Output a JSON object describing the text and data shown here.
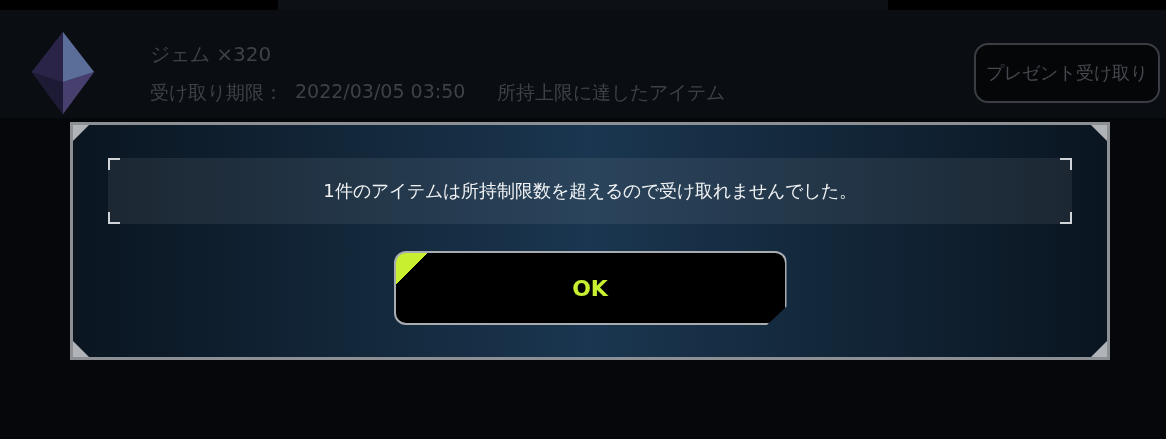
{
  "present_item": {
    "name": "ジェム ×320",
    "deadline_label": "受け取り期限：",
    "deadline": "2022/03/05 03:50",
    "note": "所持上限に達したアイテム",
    "claim_button": "プレゼント受け取り"
  },
  "dialog": {
    "message": "1件のアイテムは所持制限数を超えるので受け取れませんでした。",
    "button": "OK"
  }
}
